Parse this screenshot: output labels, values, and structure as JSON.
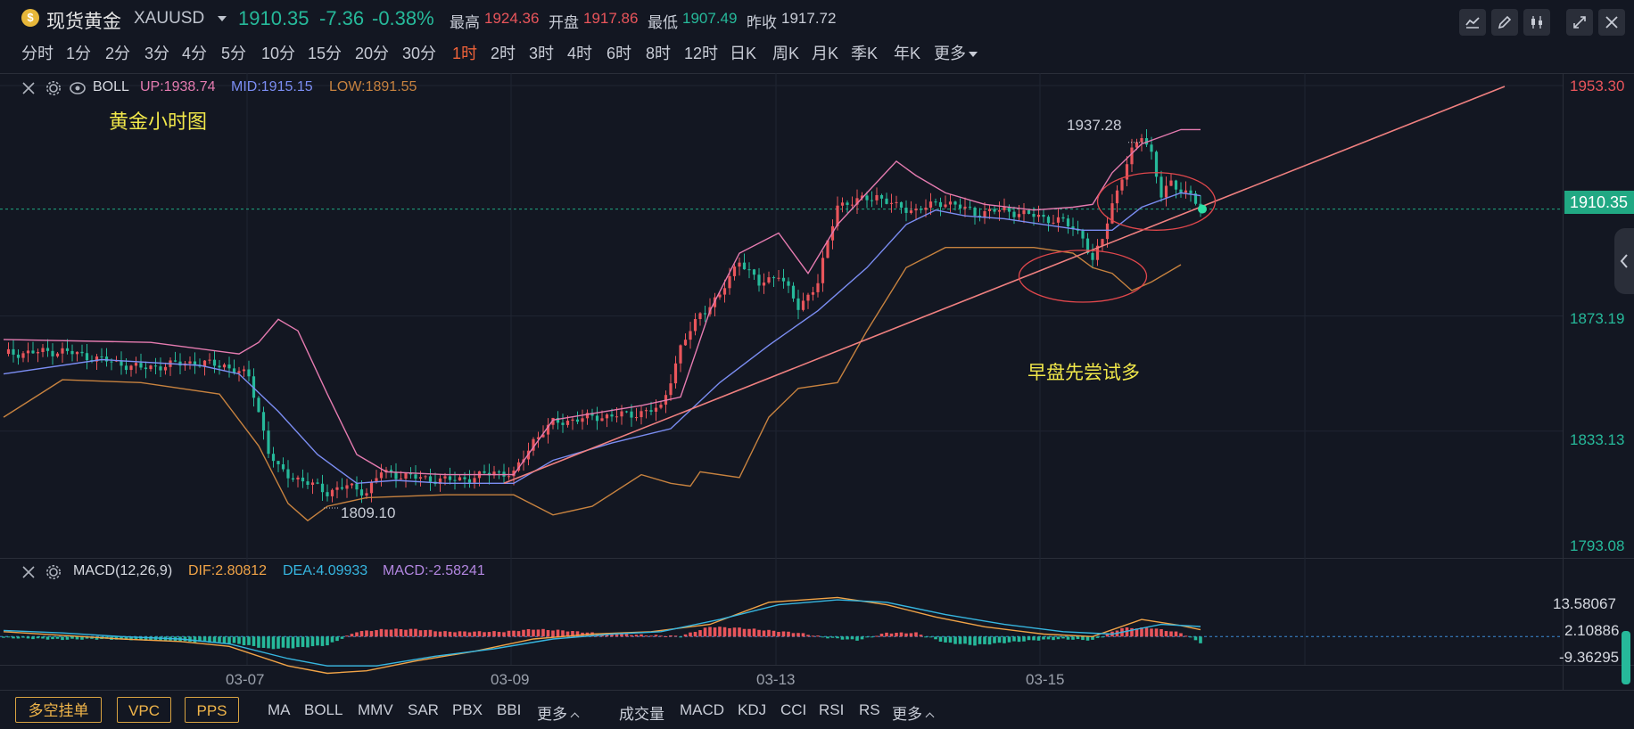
{
  "header": {
    "coin_glyph": "$",
    "name": "现货黄金",
    "code": "XAUUSD",
    "price": "1910.35",
    "change": "-7.36",
    "change_pct": "-0.38%",
    "high_label": "最高",
    "high_value": "1924.36",
    "open_label": "开盘",
    "open_value": "1917.86",
    "low_label": "最低",
    "low_value": "1907.49",
    "prev_label": "昨收",
    "prev_value": "1917.72"
  },
  "toolbar_icons": [
    "indicator-settings-icon",
    "draw-pencil-icon",
    "candle-style-icon",
    "expand-icon",
    "close-icon"
  ],
  "periods": [
    "分时",
    "1分",
    "2分",
    "3分",
    "4分",
    "5分",
    "10分",
    "15分",
    "20分",
    "30分",
    "1时",
    "2时",
    "3时",
    "4时",
    "6时",
    "8时",
    "12时",
    "日K",
    "周K",
    "月K",
    "季K",
    "年K",
    "更多"
  ],
  "active_period": "1时",
  "boll": {
    "name": "BOLL",
    "up": "UP:1938.74",
    "mid": "MID:1915.15",
    "low": "LOW:1891.55"
  },
  "macd_panel": {
    "name": "MACD(12,26,9)",
    "dif": "DIF:2.80812",
    "dea": "DEA:4.09933",
    "macd": "MACD:-2.58241"
  },
  "colors": {
    "up": "#e9555b",
    "down": "#26b99a",
    "boll_up": "#e57bb0",
    "boll_mid": "#7b8df2",
    "boll_low": "#c7823f",
    "trendline": "#f08080",
    "annotation": "#f1e84a",
    "dif": "#f0a347",
    "dea": "#36b6e0",
    "background": "#131722"
  },
  "annotations": {
    "title": "黄金小时图",
    "note": "早盘先尝试多",
    "high_mark": "1937.28",
    "low_mark": "1809.10"
  },
  "price_axis": {
    "current": "1910.35",
    "labels": [
      "1953.30",
      "1873.19",
      "1833.13",
      "1793.08"
    ]
  },
  "macd_axis": [
    "13.58067",
    "2.10886",
    "-9.36295"
  ],
  "x_labels": [
    "03-07",
    "03-09",
    "03-13",
    "03-15"
  ],
  "bottom_buttons": [
    "多空挂单",
    "VPC",
    "PPS"
  ],
  "bottom_items_left": [
    "MA",
    "BOLL",
    "MMV",
    "SAR",
    "PBX",
    "BBI",
    "更多"
  ],
  "bottom_items_right": [
    "成交量",
    "MACD",
    "KDJ",
    "CCI",
    "RSI",
    "RS",
    "更多"
  ],
  "chart_data": {
    "type": "candlestick",
    "title": "黄金小时图",
    "symbol": "XAUUSD",
    "timeframe": "1时",
    "ylim": [
      1793.08,
      1953.3
    ],
    "price_axis_ticks": [
      1953.3,
      1910.35,
      1873.19,
      1833.13,
      1793.08
    ],
    "x_tick_labels": [
      "03-07",
      "03-09",
      "03-13",
      "03-15"
    ],
    "close_path": [
      [
        0,
        1860
      ],
      [
        12,
        1861
      ],
      [
        20,
        1858
      ],
      [
        28,
        1855
      ],
      [
        38,
        1857
      ],
      [
        45,
        1856
      ],
      [
        50,
        1852
      ],
      [
        52,
        1840
      ],
      [
        54,
        1826
      ],
      [
        56,
        1820
      ],
      [
        58,
        1818
      ],
      [
        62,
        1815
      ],
      [
        66,
        1812
      ],
      [
        70,
        1814
      ],
      [
        74,
        1812
      ],
      [
        77,
        1819
      ],
      [
        80,
        1818
      ],
      [
        84,
        1817
      ],
      [
        90,
        1816
      ],
      [
        96,
        1817
      ],
      [
        100,
        1819
      ],
      [
        104,
        1818
      ],
      [
        108,
        1830
      ],
      [
        112,
        1836
      ],
      [
        120,
        1838
      ],
      [
        128,
        1839
      ],
      [
        134,
        1841
      ],
      [
        138,
        1862
      ],
      [
        142,
        1874
      ],
      [
        146,
        1880
      ],
      [
        150,
        1893
      ],
      [
        154,
        1884
      ],
      [
        158,
        1888
      ],
      [
        162,
        1876
      ],
      [
        166,
        1885
      ],
      [
        170,
        1912
      ],
      [
        174,
        1913
      ],
      [
        178,
        1915
      ],
      [
        182,
        1911
      ],
      [
        186,
        1910
      ],
      [
        192,
        1913
      ],
      [
        198,
        1909
      ],
      [
        204,
        1910
      ],
      [
        210,
        1908
      ],
      [
        216,
        1906
      ],
      [
        220,
        1901
      ],
      [
        222,
        1892
      ],
      [
        224,
        1900
      ],
      [
        226,
        1912
      ],
      [
        228,
        1922
      ],
      [
        230,
        1930
      ],
      [
        232,
        1936
      ],
      [
        234,
        1930
      ],
      [
        236,
        1915
      ],
      [
        238,
        1919
      ],
      [
        240,
        1917
      ],
      [
        242,
        1916
      ],
      [
        244,
        1910
      ]
    ],
    "boll_upper_path": [
      [
        0,
        1865
      ],
      [
        30,
        1864
      ],
      [
        48,
        1860
      ],
      [
        52,
        1864
      ],
      [
        56,
        1872
      ],
      [
        60,
        1868
      ],
      [
        66,
        1846
      ],
      [
        72,
        1825
      ],
      [
        78,
        1819
      ],
      [
        90,
        1818
      ],
      [
        104,
        1818
      ],
      [
        112,
        1837
      ],
      [
        130,
        1842
      ],
      [
        138,
        1845
      ],
      [
        144,
        1875
      ],
      [
        150,
        1895
      ],
      [
        158,
        1902
      ],
      [
        164,
        1888
      ],
      [
        170,
        1905
      ],
      [
        176,
        1916
      ],
      [
        182,
        1927
      ],
      [
        186,
        1922
      ],
      [
        192,
        1916
      ],
      [
        200,
        1912
      ],
      [
        210,
        1910
      ],
      [
        218,
        1911
      ],
      [
        222,
        1912
      ],
      [
        226,
        1923
      ],
      [
        232,
        1933
      ],
      [
        240,
        1938
      ],
      [
        244,
        1938
      ]
    ],
    "boll_mid_path": [
      [
        0,
        1853
      ],
      [
        20,
        1858
      ],
      [
        40,
        1856
      ],
      [
        48,
        1853
      ],
      [
        56,
        1840
      ],
      [
        64,
        1825
      ],
      [
        72,
        1815
      ],
      [
        80,
        1816
      ],
      [
        90,
        1815
      ],
      [
        104,
        1815
      ],
      [
        112,
        1823
      ],
      [
        124,
        1829
      ],
      [
        136,
        1834
      ],
      [
        146,
        1850
      ],
      [
        156,
        1863
      ],
      [
        166,
        1875
      ],
      [
        176,
        1890
      ],
      [
        184,
        1905
      ],
      [
        190,
        1910
      ],
      [
        196,
        1908
      ],
      [
        204,
        1907
      ],
      [
        212,
        1905
      ],
      [
        220,
        1903
      ],
      [
        226,
        1903
      ],
      [
        232,
        1911
      ],
      [
        240,
        1916
      ],
      [
        244,
        1915
      ]
    ],
    "boll_lower_path": [
      [
        0,
        1838
      ],
      [
        12,
        1851
      ],
      [
        28,
        1850
      ],
      [
        44,
        1846
      ],
      [
        52,
        1828
      ],
      [
        58,
        1808
      ],
      [
        62,
        1802
      ],
      [
        66,
        1807
      ],
      [
        74,
        1810
      ],
      [
        90,
        1811
      ],
      [
        104,
        1811
      ],
      [
        112,
        1804
      ],
      [
        120,
        1807
      ],
      [
        130,
        1818
      ],
      [
        136,
        1815
      ],
      [
        140,
        1814
      ],
      [
        142,
        1819
      ],
      [
        150,
        1817
      ],
      [
        156,
        1838
      ],
      [
        162,
        1848
      ],
      [
        170,
        1850
      ],
      [
        176,
        1868
      ],
      [
        184,
        1890
      ],
      [
        192,
        1897
      ],
      [
        200,
        1897
      ],
      [
        210,
        1897
      ],
      [
        218,
        1895
      ],
      [
        222,
        1890
      ],
      [
        226,
        1888
      ],
      [
        230,
        1882
      ],
      [
        234,
        1885
      ],
      [
        240,
        1891
      ]
    ],
    "trendline": [
      [
        102,
        1815
      ],
      [
        306,
        1953
      ]
    ],
    "ellipses": [
      {
        "center_x": 235,
        "center_y": 1913,
        "rx": 12,
        "ry": 10
      },
      {
        "center_x": 220,
        "center_y": 1887,
        "rx": 13,
        "ry": 9
      }
    ],
    "macd": {
      "dif_path": [
        [
          0,
          2.0
        ],
        [
          12,
          0.5
        ],
        [
          24,
          -1.0
        ],
        [
          36,
          -2.0
        ],
        [
          46,
          -4.0
        ],
        [
          58,
          -12
        ],
        [
          66,
          -15
        ],
        [
          74,
          -14
        ],
        [
          84,
          -10
        ],
        [
          96,
          -6
        ],
        [
          108,
          -1
        ],
        [
          120,
          1
        ],
        [
          132,
          2
        ],
        [
          144,
          5
        ],
        [
          156,
          14
        ],
        [
          170,
          16
        ],
        [
          180,
          13
        ],
        [
          190,
          8
        ],
        [
          200,
          4
        ],
        [
          212,
          1
        ],
        [
          222,
          0
        ],
        [
          232,
          7
        ],
        [
          240,
          4.5
        ],
        [
          244,
          2.8
        ]
      ],
      "dea_path": [
        [
          0,
          2.5
        ],
        [
          12,
          1.5
        ],
        [
          24,
          0
        ],
        [
          36,
          -1
        ],
        [
          46,
          -3
        ],
        [
          58,
          -9
        ],
        [
          66,
          -12
        ],
        [
          76,
          -12
        ],
        [
          88,
          -8
        ],
        [
          100,
          -5
        ],
        [
          112,
          -1
        ],
        [
          124,
          1
        ],
        [
          134,
          2
        ],
        [
          146,
          7
        ],
        [
          158,
          13
        ],
        [
          170,
          15
        ],
        [
          180,
          14
        ],
        [
          192,
          9
        ],
        [
          204,
          5
        ],
        [
          216,
          2
        ],
        [
          226,
          1
        ],
        [
          236,
          5
        ],
        [
          244,
          4.1
        ]
      ],
      "histogram": [
        [
          0,
          -0.5
        ],
        [
          6,
          -0.8
        ],
        [
          12,
          -1.2
        ],
        [
          18,
          -1.0
        ],
        [
          24,
          -1.2
        ],
        [
          30,
          -1.5
        ],
        [
          36,
          -2.0
        ],
        [
          42,
          -2.3
        ],
        [
          48,
          -3.0
        ],
        [
          54,
          -5.0
        ],
        [
          60,
          -4.5
        ],
        [
          66,
          -3.5
        ],
        [
          72,
          2.0
        ],
        [
          78,
          3.0
        ],
        [
          84,
          3.0
        ],
        [
          90,
          2.0
        ],
        [
          96,
          2.0
        ],
        [
          102,
          2.0
        ],
        [
          108,
          3.0
        ],
        [
          114,
          2.5
        ],
        [
          120,
          1.5
        ],
        [
          126,
          1.0
        ],
        [
          132,
          0.5
        ],
        [
          138,
          0.2
        ],
        [
          144,
          4.0
        ],
        [
          150,
          3.5
        ],
        [
          156,
          2.5
        ],
        [
          162,
          1.5
        ],
        [
          168,
          -0.5
        ],
        [
          174,
          -1.5
        ],
        [
          180,
          1.5
        ],
        [
          186,
          1.5
        ],
        [
          192,
          -2.5
        ],
        [
          198,
          -3.5
        ],
        [
          204,
          -2.5
        ],
        [
          210,
          -1.5
        ],
        [
          216,
          -1.0
        ],
        [
          222,
          -1.5
        ],
        [
          228,
          3.5
        ],
        [
          234,
          3.5
        ],
        [
          240,
          1.5
        ],
        [
          244,
          -2.5
        ]
      ]
    },
    "macd_axis_ticks": [
      13.58067,
      2.10886,
      -9.36295
    ]
  }
}
